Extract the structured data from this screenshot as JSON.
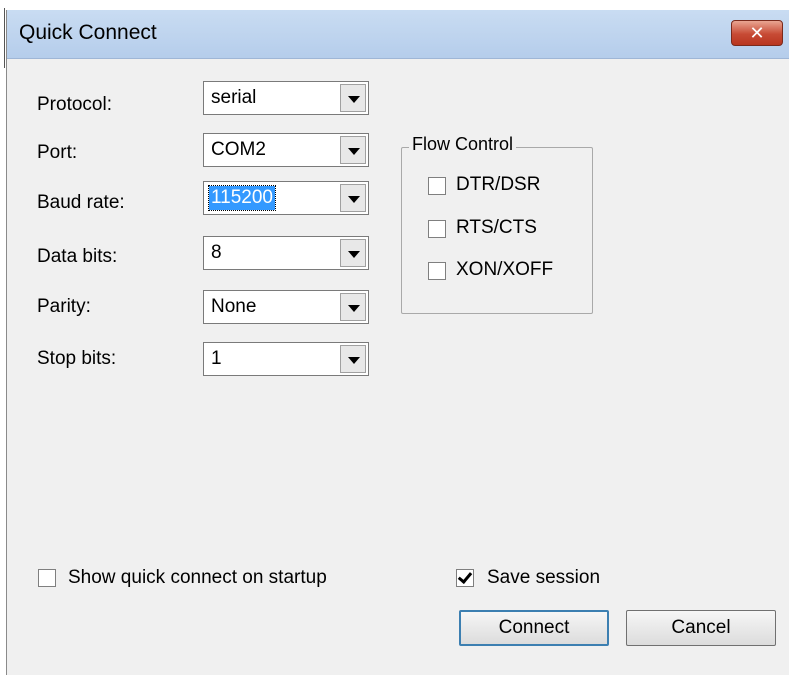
{
  "window": {
    "title": "Quick Connect",
    "close_glyph": "✕"
  },
  "fields": {
    "protocol": {
      "label": "Protocol:",
      "value": "serial"
    },
    "port": {
      "label": "Port:",
      "value": "COM2"
    },
    "baud_rate": {
      "label": "Baud rate:",
      "value": "115200"
    },
    "data_bits": {
      "label": "Data bits:",
      "value": "8"
    },
    "parity": {
      "label": "Parity:",
      "value": "None"
    },
    "stop_bits": {
      "label": "Stop bits:",
      "value": "1"
    }
  },
  "flow_control": {
    "title": "Flow Control",
    "options": [
      {
        "label": "DTR/DSR",
        "checked": false
      },
      {
        "label": "RTS/CTS",
        "checked": false
      },
      {
        "label": "XON/XOFF",
        "checked": false
      }
    ]
  },
  "options": {
    "show_on_startup": {
      "label": "Show quick connect on startup",
      "checked": false
    },
    "save_session": {
      "label": "Save session",
      "checked": true
    }
  },
  "buttons": {
    "connect": "Connect",
    "cancel": "Cancel"
  },
  "colors": {
    "selection": "#3399ff",
    "titlebar": "#c2d7f0",
    "close": "#c74a34",
    "dialog_bg": "#f0f0f0"
  }
}
